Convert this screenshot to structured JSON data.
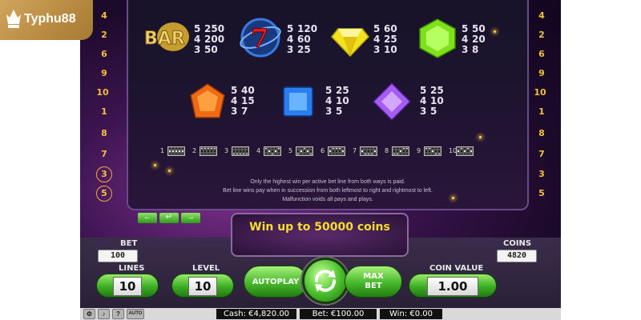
{
  "logo": {
    "text": "Typhu88",
    "icon": "crown-icon"
  },
  "left_line_numbers": [
    "4",
    "2",
    "6",
    "9",
    "10",
    "1",
    "8",
    "7",
    "3",
    "5"
  ],
  "right_line_numbers": [
    "4",
    "2",
    "6",
    "9",
    "10",
    "1",
    "8",
    "7",
    "3",
    "5"
  ],
  "paytable": {
    "symbols": [
      {
        "symbol": "bar",
        "icon": "bar-icon",
        "pays": [
          [
            "5",
            "250"
          ],
          [
            "4",
            "200"
          ],
          [
            "3",
            "50"
          ]
        ]
      },
      {
        "symbol": "seven",
        "icon": "seven-icon",
        "pays": [
          [
            "5",
            "120"
          ],
          [
            "4",
            "60"
          ],
          [
            "3",
            "25"
          ]
        ]
      },
      {
        "symbol": "yellow-gem",
        "icon": "yellow-gem-icon",
        "color": "#f2e21e",
        "pays": [
          [
            "5",
            "60"
          ],
          [
            "4",
            "25"
          ],
          [
            "3",
            "10"
          ]
        ]
      },
      {
        "symbol": "green-gem",
        "icon": "green-gem-icon",
        "color": "#7ee11c",
        "pays": [
          [
            "5",
            "50"
          ],
          [
            "4",
            "20"
          ],
          [
            "3",
            "8"
          ]
        ]
      },
      {
        "symbol": "orange-gem",
        "icon": "orange-gem-icon",
        "color": "#f06a14",
        "pays": [
          [
            "5",
            "40"
          ],
          [
            "4",
            "15"
          ],
          [
            "3",
            "7"
          ]
        ]
      },
      {
        "symbol": "blue-gem",
        "icon": "blue-gem-icon",
        "color": "#2a7ef0",
        "pays": [
          [
            "5",
            "25"
          ],
          [
            "4",
            "10"
          ],
          [
            "3",
            "5"
          ]
        ]
      },
      {
        "symbol": "purple-gem",
        "icon": "purple-gem-icon",
        "color": "#a55cf0",
        "pays": [
          [
            "5",
            "25"
          ],
          [
            "4",
            "10"
          ],
          [
            "3",
            "5"
          ]
        ]
      }
    ],
    "lines": [
      "1",
      "2",
      "3",
      "4",
      "5",
      "6",
      "7",
      "8",
      "9",
      "10"
    ],
    "rules": [
      "Only the highest win per active bet line from both ways is paid.",
      "Bet line wins pay when in succession from both leftmost to right and rightmost to left.",
      "Malfunction voids all pays and plays."
    ]
  },
  "win_message": "Win up to 50000 coins",
  "controls": {
    "bet_label": "BET",
    "bet_value": "100",
    "lines_label": "LINES",
    "lines_value": "10",
    "level_label": "LEVEL",
    "level_value": "10",
    "autoplay_label": "AUTOPLAY",
    "max_bet_label": "MAX\nBET",
    "coins_label": "COINS",
    "coins_value": "4820",
    "coin_value_label": "COIN VALUE",
    "coin_value": "1.00"
  },
  "status": {
    "cash": "Cash: €4,820.00",
    "bet": "Bet: €100.00",
    "win": "Win: €0.00",
    "auto_label": "AUTO",
    "help_label": "?"
  },
  "colors": {
    "accent_green": "#45b82a",
    "win_text": "#f5dd2e",
    "line_number": "#f2c03a"
  }
}
